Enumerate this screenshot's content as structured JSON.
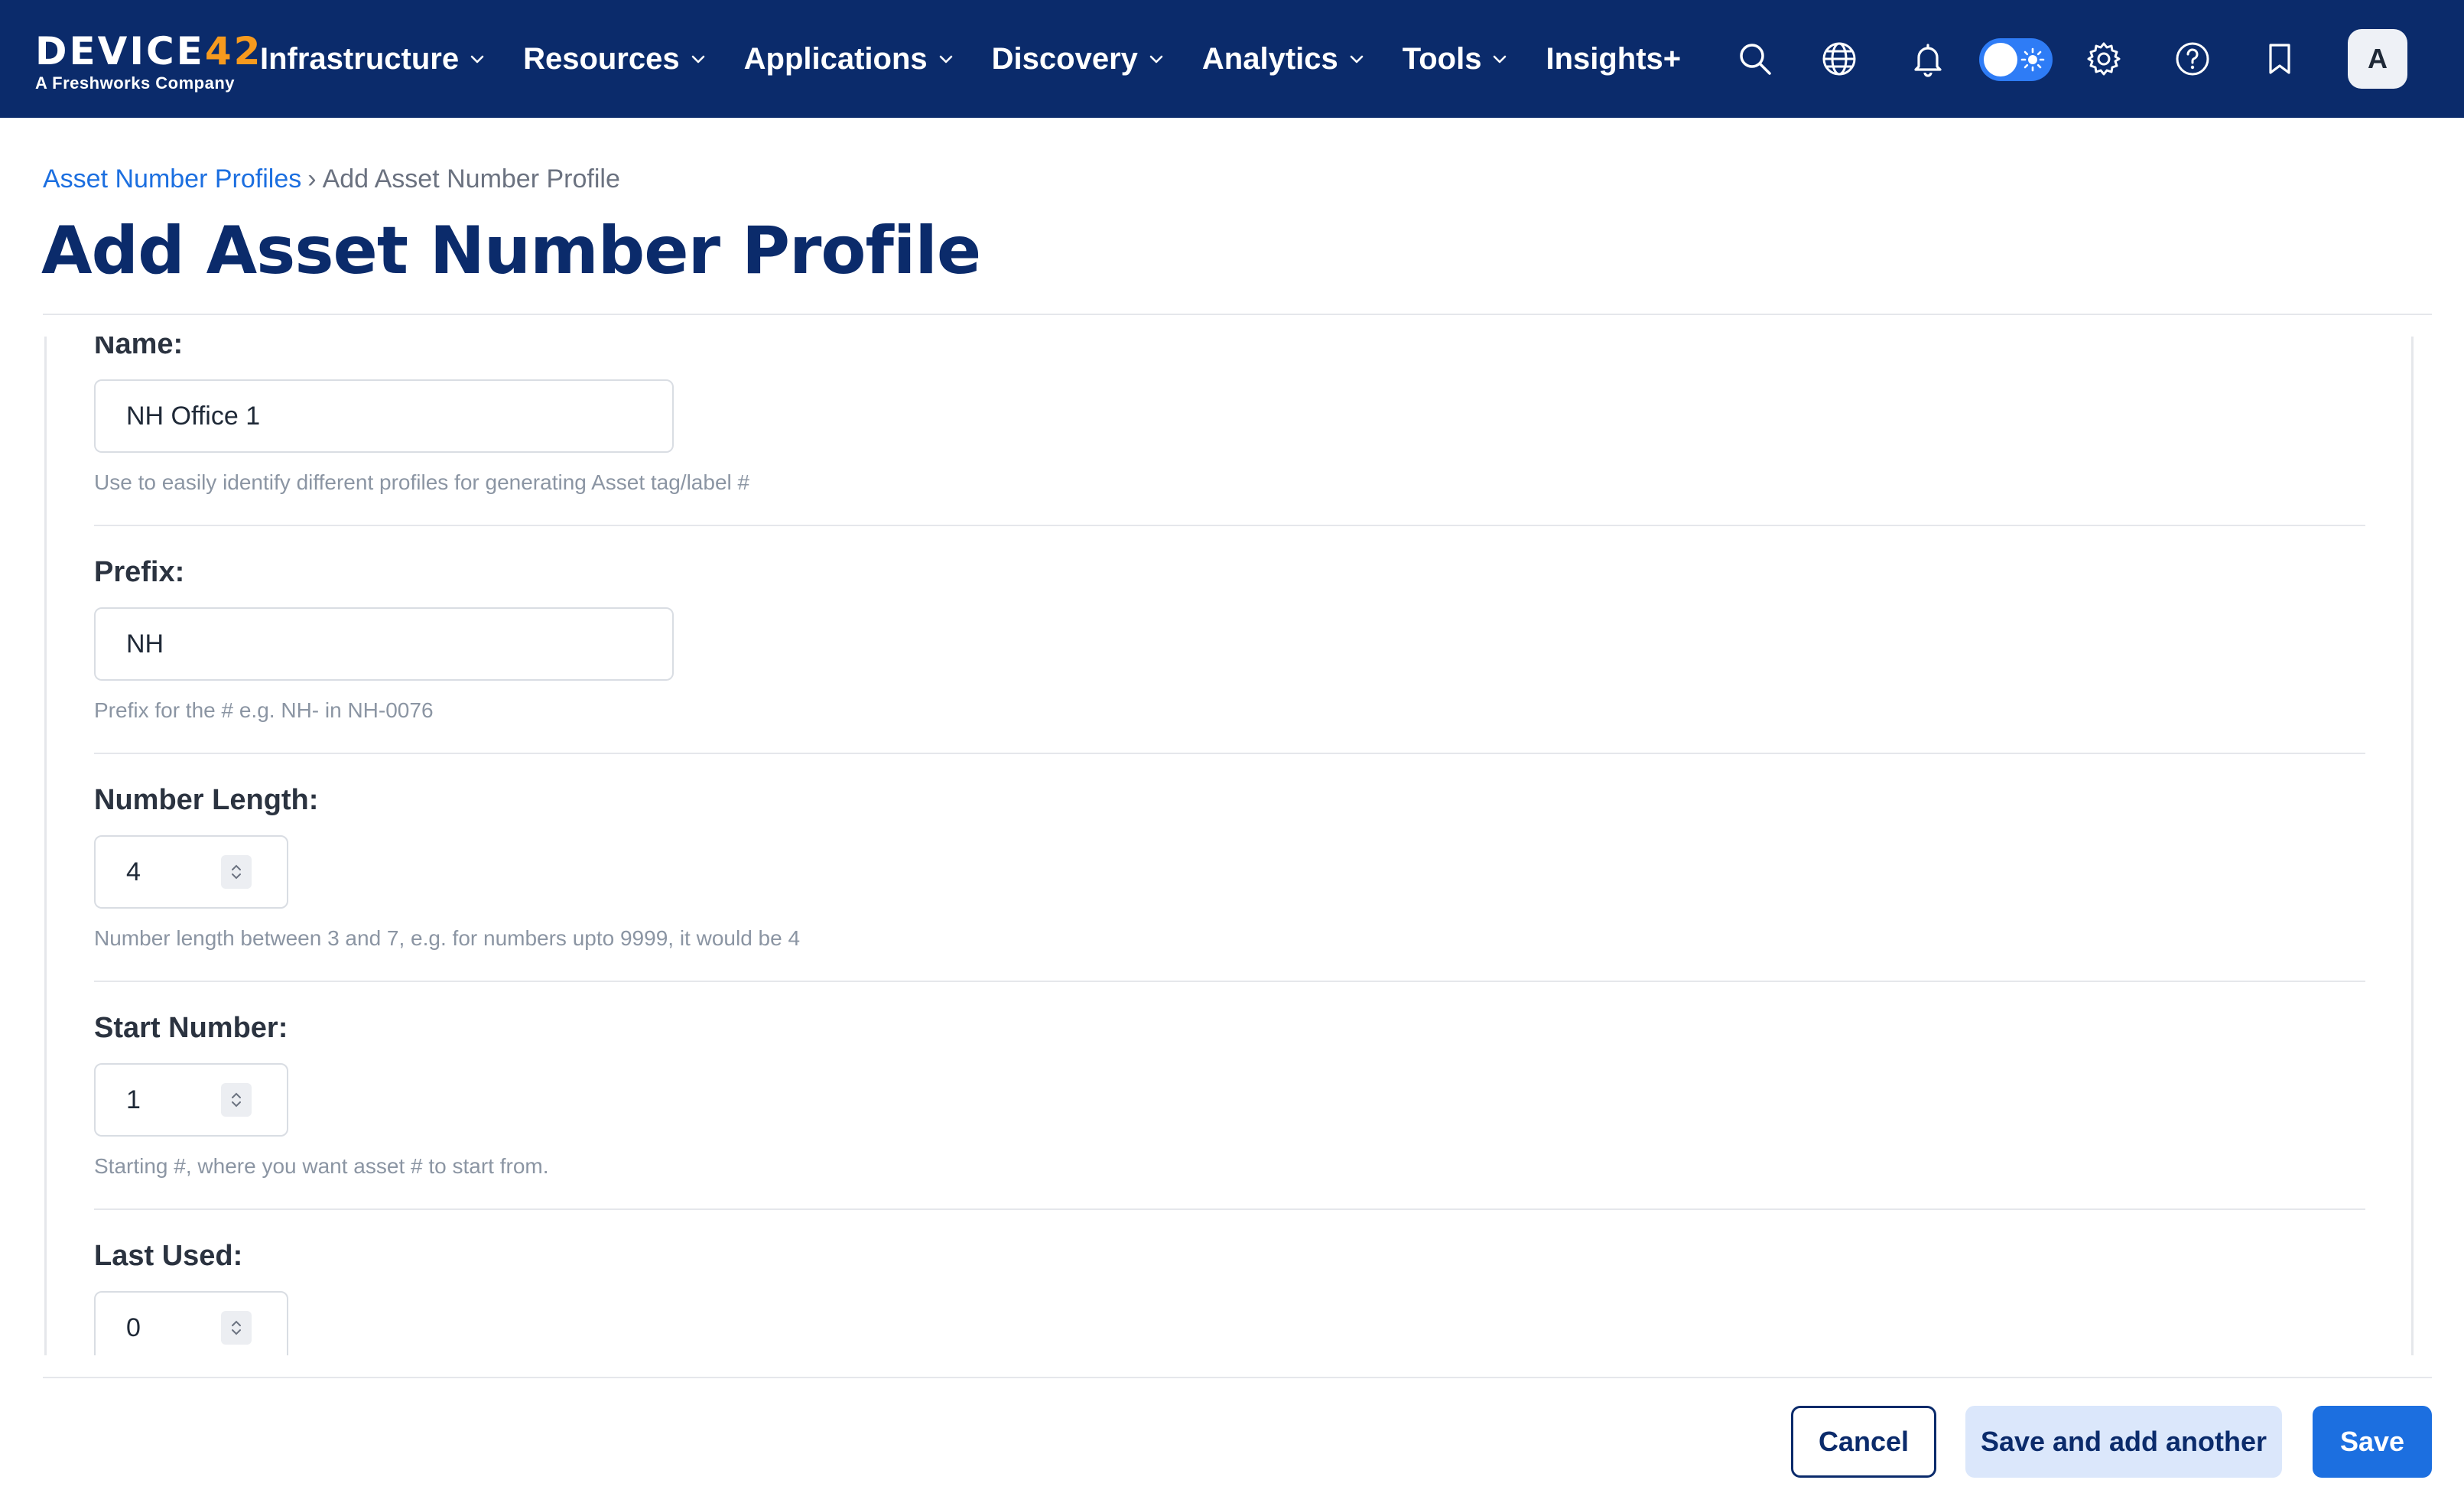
{
  "brand": {
    "logo_main": "DEVICE",
    "logo_accent": "42",
    "logo_sub": "A Freshworks Company"
  },
  "nav": {
    "items": [
      {
        "label": "Infrastructure",
        "has_dropdown": true
      },
      {
        "label": "Resources",
        "has_dropdown": true
      },
      {
        "label": "Applications",
        "has_dropdown": true
      },
      {
        "label": "Discovery",
        "has_dropdown": true
      },
      {
        "label": "Analytics",
        "has_dropdown": true
      },
      {
        "label": "Tools",
        "has_dropdown": true
      },
      {
        "label": "Insights+",
        "has_dropdown": false
      }
    ]
  },
  "toolbar": {
    "icons": [
      "search-icon",
      "globe-icon",
      "bell-icon",
      "theme-toggle",
      "gear-icon",
      "help-icon",
      "bookmark-icon"
    ],
    "theme": "light",
    "avatar_initial": "A"
  },
  "breadcrumb": {
    "parent": "Asset Number Profiles",
    "separator": "›",
    "current": "Add Asset Number Profile"
  },
  "page": {
    "title": "Add Asset Number Profile"
  },
  "form": {
    "name": {
      "label": "Name:",
      "value": "NH Office 1",
      "help": "Use to easily identify different profiles for generating Asset tag/label #"
    },
    "prefix": {
      "label": "Prefix:",
      "value": "NH",
      "help": "Prefix for the # e.g. NH- in NH-0076"
    },
    "number_length": {
      "label": "Number Length:",
      "value": "4",
      "help": "Number length between 3 and 7, e.g. for numbers upto 9999, it would be 4"
    },
    "start_number": {
      "label": "Start Number:",
      "value": "1",
      "help": "Starting #, where you want asset # to start from."
    },
    "last_used": {
      "label": "Last Used:",
      "value": "0"
    }
  },
  "actions": {
    "cancel": "Cancel",
    "save_and_add_another": "Save and add another",
    "save": "Save"
  },
  "colors": {
    "nav_bg": "#0b2b6b",
    "logo_accent": "#f79a1e",
    "link": "#1c6fe0",
    "title": "#0b2b6b",
    "primary_button": "#1c6fe0",
    "secondary_button": "#dbe7fb",
    "toggle": "#2e7cf6"
  }
}
